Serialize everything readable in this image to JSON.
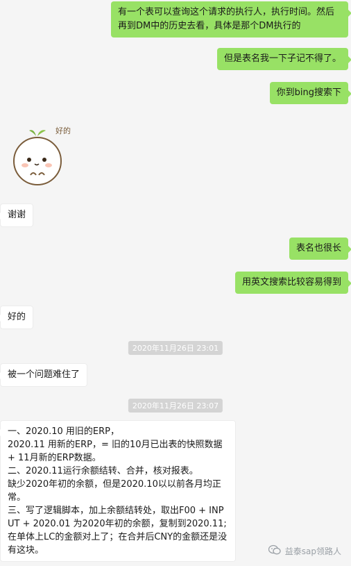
{
  "messages": {
    "m1": "有一个表可以查询这个请求的执行人，执行时间。然后再到DM中的历史去看，具体是那个DM执行的",
    "m2": "但是表名我一下子记不得了。",
    "m3": "你到bing搜索下",
    "m4": "谢谢",
    "m5": "表名也很长",
    "m6": "用英文搜索比较容易得到",
    "m7": "好的",
    "m8": "被一个问题难住了"
  },
  "sticker": {
    "text": "好的",
    "icon": "smiling-bean-sticker-icon"
  },
  "timestamps": {
    "t1": "2020年11月26日 23:01",
    "t2": "2020年11月26日 23:07"
  },
  "long_message": {
    "lines": [
      "一、2020.10 用旧的ERP，",
      "2020.11 用新的ERP，= 旧的10月已出表的快照数据 + 11月新的ERP数据。",
      "二、2020.11运行余额结转、合并，核对报表。",
      "缺少2020年初的余额，但是2020.10以以前各月均正常。",
      "三、写了逻辑脚本，加上余额结转处，取出F00 + INPUT + 2020.01 为2020年初的余额，复制到2020.11; 在单体上LC的金额对上了；在合并后CNY的金额还是没有这块。"
    ]
  },
  "watermark": {
    "text": "益泰sap领路人",
    "icon": "wechat-official-account-icon"
  },
  "colors": {
    "sent_bubble": "#98e165",
    "received_bubble": "#ffffff",
    "background": "#f5f5f5"
  }
}
